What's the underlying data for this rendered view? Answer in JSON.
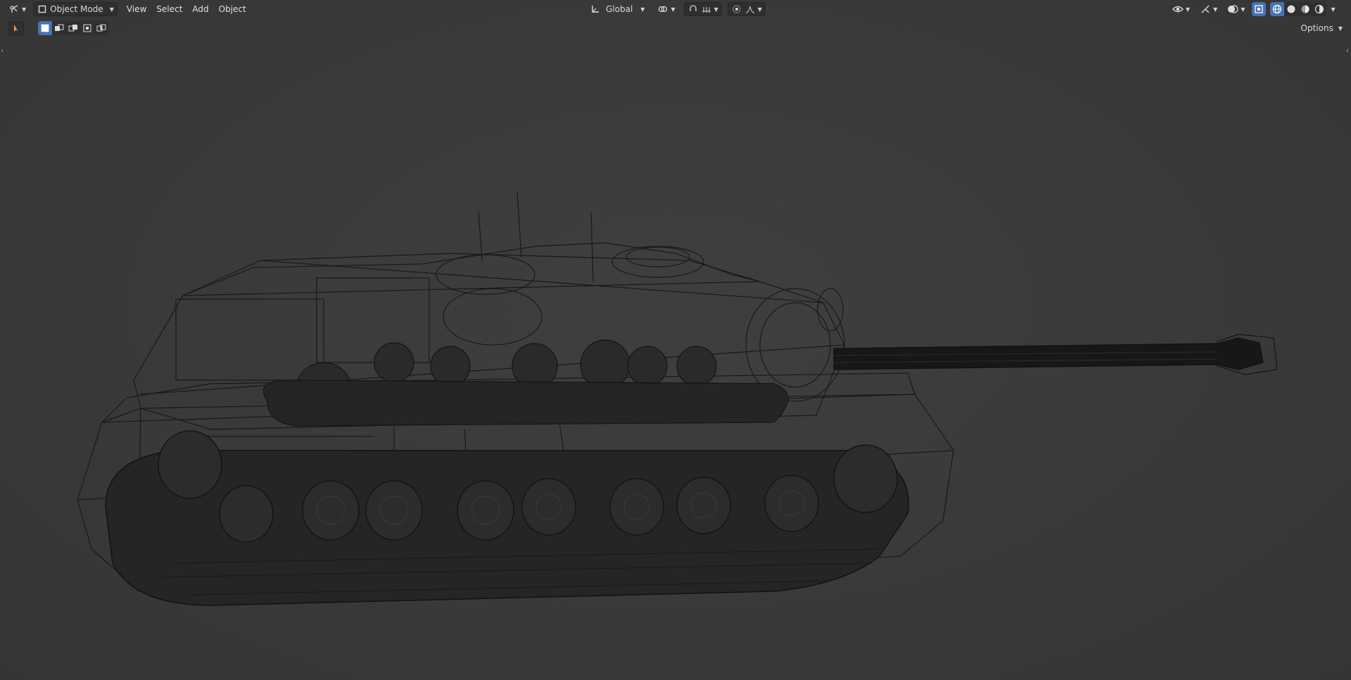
{
  "header": {
    "editor_type_icon": "3d-viewport-icon",
    "mode_label": "Object Mode",
    "menus": [
      "View",
      "Select",
      "Add",
      "Object"
    ],
    "transform_orientation": "Global"
  },
  "tool_header": {
    "options_label": "Options"
  },
  "colors": {
    "background": "#3c3c3c",
    "accent": "#4772b3",
    "wireframe": "#141414"
  }
}
